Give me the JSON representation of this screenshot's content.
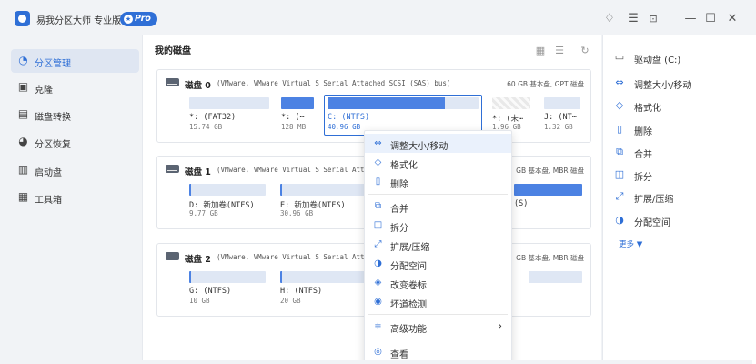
{
  "app": {
    "title": "易我分区大师 专业版",
    "badge": "Pro",
    "badge_icon": "star-icon"
  },
  "window_controls": [
    "bell-icon",
    "menu-icon",
    "download-icon",
    "minimize-icon",
    "maximize-icon",
    "close-icon"
  ],
  "sidebar": {
    "items": [
      {
        "label": "分区管理",
        "icon": "pie-chart-icon",
        "active": true
      },
      {
        "label": "克隆",
        "icon": "clone-icon",
        "active": false
      },
      {
        "label": "磁盘转换",
        "icon": "disk-convert-icon",
        "active": false
      },
      {
        "label": "分区恢复",
        "icon": "recovery-icon",
        "active": false
      },
      {
        "label": "启动盘",
        "icon": "boot-disk-icon",
        "active": false
      },
      {
        "label": "工具箱",
        "icon": "toolbox-icon",
        "active": false
      }
    ]
  },
  "main": {
    "title": "我的磁盘",
    "disks": [
      {
        "name": "磁盘 0",
        "desc": "(VMware,  VMware Virtual S Serial Attached SCSI (SAS) bus)",
        "right": "60 GB 基本盘, GPT 磁盘",
        "partitions": [
          {
            "name": "*: (FAT32)",
            "size": "15.74 GB",
            "used_fraction": 0.0
          },
          {
            "name": "*: (⋯",
            "size": "128 MB",
            "used_fraction": 1.0
          },
          {
            "name": "C: (NTFS)",
            "size": "40.96 GB",
            "used_fraction": 0.78,
            "selected": true
          },
          {
            "name": "*: (未⋯",
            "size": "1.96 GB",
            "hatched": true
          },
          {
            "name": "J: (NT⋯",
            "size": "1.32 GB",
            "used_fraction": 0.0
          }
        ]
      },
      {
        "name": "磁盘 1",
        "desc": "(VMware,  VMware Virtual S Serial Attached",
        "right": "GB 基本盘, MBR 磁盘",
        "partitions": [
          {
            "name": "D: 新加卷(NTFS)",
            "size": "9.77 GB",
            "used_fraction": 0.02
          },
          {
            "name": "E: 新加卷(NTFS)",
            "size": "30.96 GB",
            "used_fraction": 0.02
          },
          {
            "name": "(S)",
            "size": "",
            "used_fraction": 1.0
          }
        ]
      },
      {
        "name": "磁盘 2",
        "desc": "(VMware,  VMware Virtual S Serial Attached",
        "right": "GB 基本盘, MBR 磁盘",
        "partitions": [
          {
            "name": "G: (NTFS)",
            "size": "10 GB",
            "used_fraction": 0.02
          },
          {
            "name": "H: (NTFS)",
            "size": "20 GB",
            "used_fraction": 0.02
          },
          {
            "name": "",
            "size": "",
            "used_fraction": 0.0
          }
        ]
      }
    ]
  },
  "context_menu": {
    "items": [
      {
        "label": "调整大小/移动",
        "icon": "resize-icon",
        "hover": true
      },
      {
        "label": "格式化",
        "icon": "format-icon"
      },
      {
        "label": "删除",
        "icon": "trash-icon"
      },
      {
        "label": "合并",
        "icon": "merge-icon"
      },
      {
        "label": "拆分",
        "icon": "split-icon"
      },
      {
        "label": "扩展/压缩",
        "icon": "extend-icon"
      },
      {
        "label": "分配空间",
        "icon": "allocate-icon"
      },
      {
        "label": "改变卷标",
        "icon": "label-icon"
      },
      {
        "label": "坏道检测",
        "icon": "scan-icon"
      },
      {
        "label": "高级功能",
        "icon": "advanced-icon",
        "submenu": true
      },
      {
        "label": "查看",
        "icon": "view-icon"
      }
    ]
  },
  "right_panel": {
    "drive": "驱动盘 (C:)",
    "drive_icon": "drive-icon",
    "actions": [
      {
        "label": "调整大小/移动",
        "icon": "resize-icon"
      },
      {
        "label": "格式化",
        "icon": "format-icon"
      },
      {
        "label": "删除",
        "icon": "trash-icon"
      },
      {
        "label": "合并",
        "icon": "merge-icon"
      },
      {
        "label": "拆分",
        "icon": "split-icon"
      },
      {
        "label": "扩展/压缩",
        "icon": "extend-icon"
      },
      {
        "label": "分配空间",
        "icon": "allocate-icon"
      }
    ],
    "more": "更多 ▼"
  },
  "colors": {
    "accent": "#2f6fd6",
    "partition_fill": "#4c82e3",
    "partition_bg": "#dfe7f4"
  }
}
